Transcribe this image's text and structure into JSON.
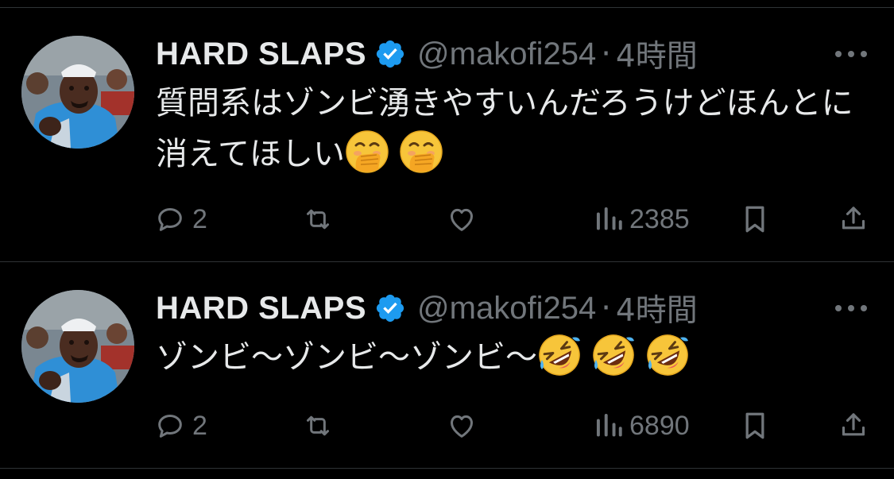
{
  "colors": {
    "background": "#000000",
    "text": "#e7e9ea",
    "muted": "#71767b",
    "divider": "#2f3336",
    "verified": "#1d9bf0"
  },
  "tweets": [
    {
      "name": "HARD SLAPS",
      "handle": "@makofi254",
      "dot": "·",
      "time": "4時間",
      "text": "質問系はゾンビ湧きやすいんだろうけどほんとに消えてほしい",
      "emoji": [
        "face-with-hand-over-mouth",
        "face-with-hand-over-mouth"
      ],
      "replies": "2",
      "views": "2385"
    },
    {
      "name": "HARD SLAPS",
      "handle": "@makofi254",
      "dot": "·",
      "time": "4時間",
      "text": "ゾンビ〜ゾンビ〜ゾンビ〜",
      "emoji": [
        "rolling-on-the-floor-laughing",
        "rolling-on-the-floor-laughing",
        "rolling-on-the-floor-laughing"
      ],
      "replies": "2",
      "views": "6890"
    }
  ]
}
